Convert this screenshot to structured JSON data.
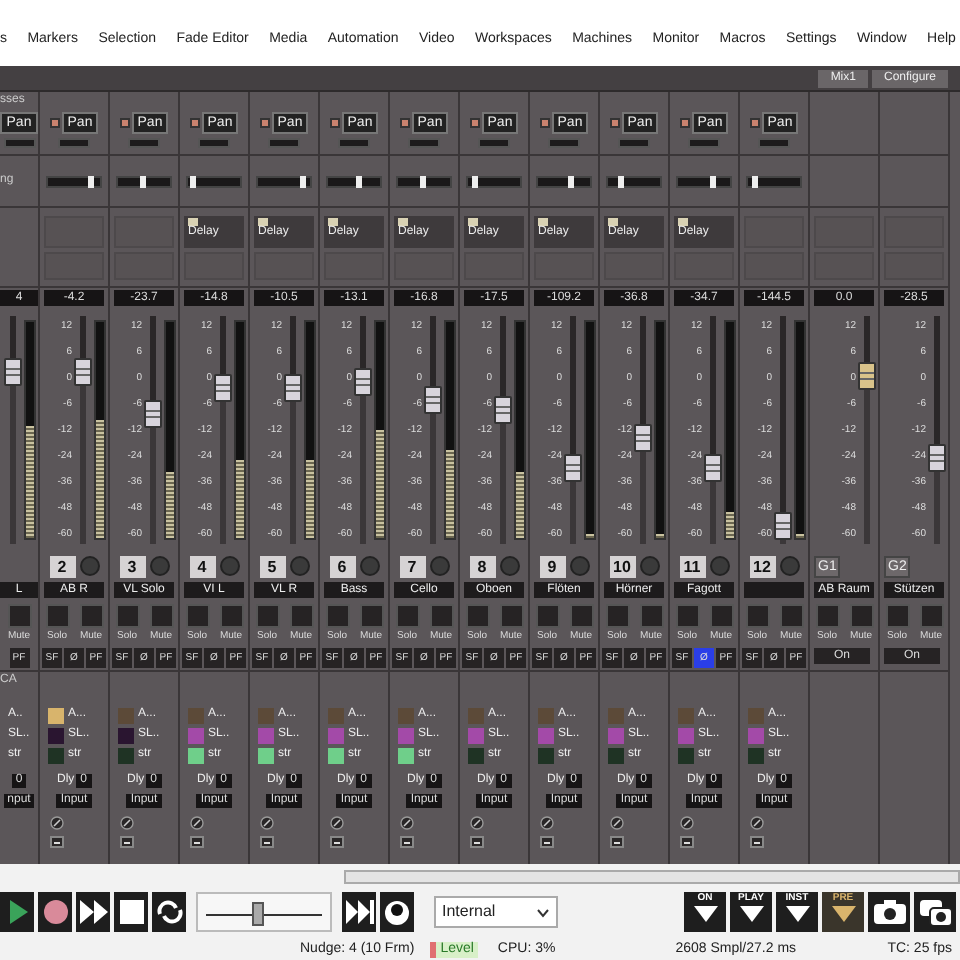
{
  "menu": [
    "s",
    "Markers",
    "Selection",
    "Fade Editor",
    "Media",
    "Automation",
    "Video",
    "Workspaces",
    "Machines",
    "Monitor",
    "Macros",
    "Settings",
    "Window",
    "Help"
  ],
  "header_buttons": [
    "Mix1",
    "Configure"
  ],
  "section_labels": {
    "busses": "sses",
    "panning": "ng",
    "vca": "CA"
  },
  "channels": [
    {
      "kind": "partial",
      "pan": {
        "label": "Pan"
      },
      "reading": "4",
      "fader": {
        "level": 0.79
      },
      "meter": {
        "level": 0.52
      },
      "name": "L",
      "mute": "Mute",
      "pf": "PF",
      "vca": [
        {
          "label": "A.."
        },
        {
          "label": "SL.."
        },
        {
          "label": "str"
        }
      ],
      "delay": "0",
      "input": "nput"
    },
    {
      "kind": "channel",
      "pan": {
        "label": "Pan",
        "level": 0.85
      },
      "reading": "-4.2",
      "scale": [
        "12",
        "6",
        "0",
        "-6",
        "-12",
        "-24",
        "-36",
        "-48",
        "-60"
      ],
      "fader": {
        "level": 0.79
      },
      "meter": {
        "level": 0.55
      },
      "number": "2",
      "name": "AB R",
      "solo": "Solo",
      "mute": "Mute",
      "sf": "SF",
      "phase": "Ø",
      "phase_on": false,
      "pf": "PF",
      "vca": [
        {
          "label": "A...",
          "color": "#d8b46c"
        },
        {
          "label": "SL..",
          "color": "#2a1530"
        },
        {
          "label": "str",
          "color": "#1f3324"
        }
      ],
      "dly": "Dly",
      "delay": "0",
      "input": "Input"
    },
    {
      "kind": "channel",
      "pan": {
        "label": "Pan",
        "level": 0.5
      },
      "reading": "-23.7",
      "scale": [
        "12",
        "6",
        "0",
        "-6",
        "-12",
        "-24",
        "-36",
        "-48",
        "-60"
      ],
      "fader": {
        "level": 0.58
      },
      "meter": {
        "level": 0.31
      },
      "number": "3",
      "name": "VL Solo",
      "solo": "Solo",
      "mute": "Mute",
      "sf": "SF",
      "phase": "Ø",
      "phase_on": false,
      "pf": "PF",
      "vca": [
        {
          "label": "A...",
          "color": "#5c4a38"
        },
        {
          "label": "SL..",
          "color": "#2a1530"
        },
        {
          "label": "str",
          "color": "#1f3324"
        }
      ],
      "dly": "Dly",
      "delay": "0",
      "input": "Input"
    },
    {
      "kind": "channel",
      "pan": {
        "label": "Pan",
        "level": 0.1
      },
      "insert": "Delay",
      "reading": "-14.8",
      "scale": [
        "12",
        "6",
        "0",
        "-6",
        "-12",
        "-24",
        "-36",
        "-48",
        "-60"
      ],
      "fader": {
        "level": 0.71
      },
      "meter": {
        "level": 0.36
      },
      "number": "4",
      "name": "VI L",
      "solo": "Solo",
      "mute": "Mute",
      "sf": "SF",
      "phase": "Ø",
      "phase_on": false,
      "pf": "PF",
      "vca": [
        {
          "label": "A...",
          "color": "#5c4a38"
        },
        {
          "label": "SL..",
          "color": "#a34aa8"
        },
        {
          "label": "str",
          "color": "#6fcf8a"
        }
      ],
      "dly": "Dly",
      "delay": "0",
      "input": "Input"
    },
    {
      "kind": "channel",
      "pan": {
        "label": "Pan",
        "level": 0.9
      },
      "insert": "Delay",
      "reading": "-10.5",
      "scale": [
        "12",
        "6",
        "0",
        "-6",
        "-12",
        "-24",
        "-36",
        "-48",
        "-60"
      ],
      "fader": {
        "level": 0.71
      },
      "meter": {
        "level": 0.36
      },
      "number": "5",
      "name": "VL R",
      "solo": "Solo",
      "mute": "Mute",
      "sf": "SF",
      "phase": "Ø",
      "phase_on": false,
      "pf": "PF",
      "vca": [
        {
          "label": "A...",
          "color": "#5c4a38"
        },
        {
          "label": "SL..",
          "color": "#a34aa8"
        },
        {
          "label": "str",
          "color": "#6fcf8a"
        }
      ],
      "dly": "Dly",
      "delay": "0",
      "input": "Input"
    },
    {
      "kind": "channel",
      "pan": {
        "label": "Pan",
        "level": 0.6
      },
      "insert": "Delay",
      "reading": "-13.1",
      "scale": [
        "12",
        "6",
        "0",
        "-6",
        "-12",
        "-24",
        "-36",
        "-48",
        "-60"
      ],
      "fader": {
        "level": 0.74
      },
      "meter": {
        "level": 0.5
      },
      "number": "6",
      "name": "Bass",
      "solo": "Solo",
      "mute": "Mute",
      "sf": "SF",
      "phase": "Ø",
      "phase_on": false,
      "pf": "PF",
      "vca": [
        {
          "label": "A...",
          "color": "#5c4a38"
        },
        {
          "label": "SL..",
          "color": "#a34aa8"
        },
        {
          "label": "str",
          "color": "#6fcf8a"
        }
      ],
      "dly": "Dly",
      "delay": "0",
      "input": "Input"
    },
    {
      "kind": "channel",
      "pan": {
        "label": "Pan",
        "level": 0.5
      },
      "insert": "Delay",
      "reading": "-16.8",
      "scale": [
        "12",
        "6",
        "0",
        "-6",
        "-12",
        "-24",
        "-36",
        "-48",
        "-60"
      ],
      "fader": {
        "level": 0.65
      },
      "meter": {
        "level": 0.41
      },
      "number": "7",
      "name": "Cello",
      "solo": "Solo",
      "mute": "Mute",
      "sf": "SF",
      "phase": "Ø",
      "phase_on": false,
      "pf": "PF",
      "vca": [
        {
          "label": "A...",
          "color": "#5c4a38"
        },
        {
          "label": "SL..",
          "color": "#a34aa8"
        },
        {
          "label": "str",
          "color": "#6fcf8a"
        }
      ],
      "dly": "Dly",
      "delay": "0",
      "input": "Input"
    },
    {
      "kind": "channel",
      "pan": {
        "label": "Pan",
        "level": 0.15
      },
      "insert": "Delay",
      "reading": "-17.5",
      "scale": [
        "12",
        "6",
        "0",
        "-6",
        "-12",
        "-24",
        "-36",
        "-48",
        "-60"
      ],
      "fader": {
        "level": 0.6
      },
      "meter": {
        "level": 0.31
      },
      "number": "8",
      "name": "Oboen",
      "solo": "Solo",
      "mute": "Mute",
      "sf": "SF",
      "phase": "Ø",
      "phase_on": false,
      "pf": "PF",
      "vca": [
        {
          "label": "A...",
          "color": "#5c4a38"
        },
        {
          "label": "SL..",
          "color": "#a34aa8"
        },
        {
          "label": "str",
          "color": "#1f3324"
        }
      ],
      "dly": "Dly",
      "delay": "0",
      "input": "Input"
    },
    {
      "kind": "channel",
      "pan": {
        "label": "Pan",
        "level": 0.65
      },
      "insert": "Delay",
      "reading": "-109.2",
      "scale": [
        "12",
        "6",
        "0",
        "-6",
        "-12",
        "-24",
        "-36",
        "-48",
        "-60"
      ],
      "fader": {
        "level": 0.31
      },
      "meter": {
        "level": 0.02
      },
      "number": "9",
      "name": "Flöten",
      "solo": "Solo",
      "mute": "Mute",
      "sf": "SF",
      "phase": "Ø",
      "phase_on": false,
      "pf": "PF",
      "vca": [
        {
          "label": "A...",
          "color": "#5c4a38"
        },
        {
          "label": "SL..",
          "color": "#a34aa8"
        },
        {
          "label": "str",
          "color": "#1f3324"
        }
      ],
      "dly": "Dly",
      "delay": "0",
      "input": "Input"
    },
    {
      "kind": "channel",
      "pan": {
        "label": "Pan",
        "level": 0.25
      },
      "insert": "Delay",
      "reading": "-36.8",
      "scale": [
        "12",
        "6",
        "0",
        "-6",
        "-12",
        "-24",
        "-36",
        "-48",
        "-60"
      ],
      "fader": {
        "level": 0.46
      },
      "meter": {
        "level": 0.02
      },
      "number": "10",
      "name": "Hörner",
      "solo": "Solo",
      "mute": "Mute",
      "sf": "SF",
      "phase": "Ø",
      "phase_on": false,
      "pf": "PF",
      "vca": [
        {
          "label": "A...",
          "color": "#5c4a38"
        },
        {
          "label": "SL..",
          "color": "#a34aa8"
        },
        {
          "label": "str",
          "color": "#1f3324"
        }
      ],
      "dly": "Dly",
      "delay": "0",
      "input": "Input"
    },
    {
      "kind": "channel",
      "pan": {
        "label": "Pan",
        "level": 0.7
      },
      "insert": "Delay",
      "reading": "-34.7",
      "scale": [
        "12",
        "6",
        "0",
        "-6",
        "-12",
        "-24",
        "-36",
        "-48",
        "-60"
      ],
      "fader": {
        "level": 0.31
      },
      "meter": {
        "level": 0.12
      },
      "number": "11",
      "name": "Fagott",
      "solo": "Solo",
      "mute": "Mute",
      "sf": "SF",
      "phase": "Ø",
      "phase_on": true,
      "pf": "PF",
      "vca": [
        {
          "label": "A...",
          "color": "#5c4a38"
        },
        {
          "label": "SL..",
          "color": "#a34aa8"
        },
        {
          "label": "str",
          "color": "#1f3324"
        }
      ],
      "dly": "Dly",
      "delay": "0",
      "input": "Input"
    },
    {
      "kind": "channel",
      "pan": {
        "label": "Pan",
        "level": 0.15
      },
      "reading": "-144.5",
      "scale": [
        "12",
        "6",
        "0",
        "-6",
        "-12",
        "-24",
        "-36",
        "-48",
        "-60"
      ],
      "fader": {
        "level": 0.02
      },
      "meter": {
        "level": 0.02
      },
      "number": "12",
      "solo": "Solo",
      "mute": "Mute",
      "sf": "SF",
      "phase": "Ø",
      "phase_on": false,
      "pf": "PF",
      "vca": [
        {
          "label": "A...",
          "color": "#5c4a38"
        },
        {
          "label": "SL..",
          "color": "#a34aa8"
        },
        {
          "label": "str",
          "color": "#1f3324"
        }
      ],
      "dly": "Dly",
      "delay": "0",
      "input": "Input"
    },
    {
      "kind": "group",
      "reading": "0.0",
      "scale": [
        "12",
        "6",
        "0",
        "-6",
        "-12",
        "-24",
        "-36",
        "-48",
        "-60"
      ],
      "fader": {
        "level": 0.77
      },
      "number": "G1",
      "name": "AB Raum",
      "solo": "Solo",
      "mute": "Mute",
      "on": "On"
    },
    {
      "kind": "group",
      "reading": "-28.5",
      "scale": [
        "12",
        "6",
        "0",
        "-6",
        "-12",
        "-24",
        "-36",
        "-48",
        "-60"
      ],
      "fader": {
        "level": 0.36
      },
      "number": "G2",
      "name": "Stützen",
      "solo": "Solo",
      "mute": "Mute",
      "on": "On"
    }
  ],
  "transport": {
    "buttons": [
      {
        "kind": "play"
      },
      {
        "kind": "record"
      },
      {
        "kind": "forward"
      },
      {
        "kind": "stop"
      },
      {
        "kind": "loop"
      }
    ],
    "shuttle": {
      "level": 0.45
    },
    "buttons2": [
      {
        "kind": "fast_forward"
      },
      {
        "kind": "scrub"
      }
    ],
    "sync": "Internal",
    "toggles": [
      {
        "label": "ON",
        "active": false
      },
      {
        "label": "PLAY",
        "active": false
      },
      {
        "label": "INST",
        "active": false
      },
      {
        "label": "PRE",
        "active": true
      }
    ],
    "icon_buttons": [
      {
        "kind": "camera"
      },
      {
        "kind": "cameras"
      }
    ]
  },
  "status": [
    {
      "kind": "text",
      "text": "Nudge: 4 (10 Frm)"
    },
    {
      "kind": "level",
      "text": "Level"
    },
    {
      "kind": "text",
      "text": "CPU: 3%"
    },
    {
      "kind": "text",
      "text": "2608 Smpl/27.2 ms"
    },
    {
      "kind": "text",
      "text": "TC: 25 fps"
    }
  ]
}
